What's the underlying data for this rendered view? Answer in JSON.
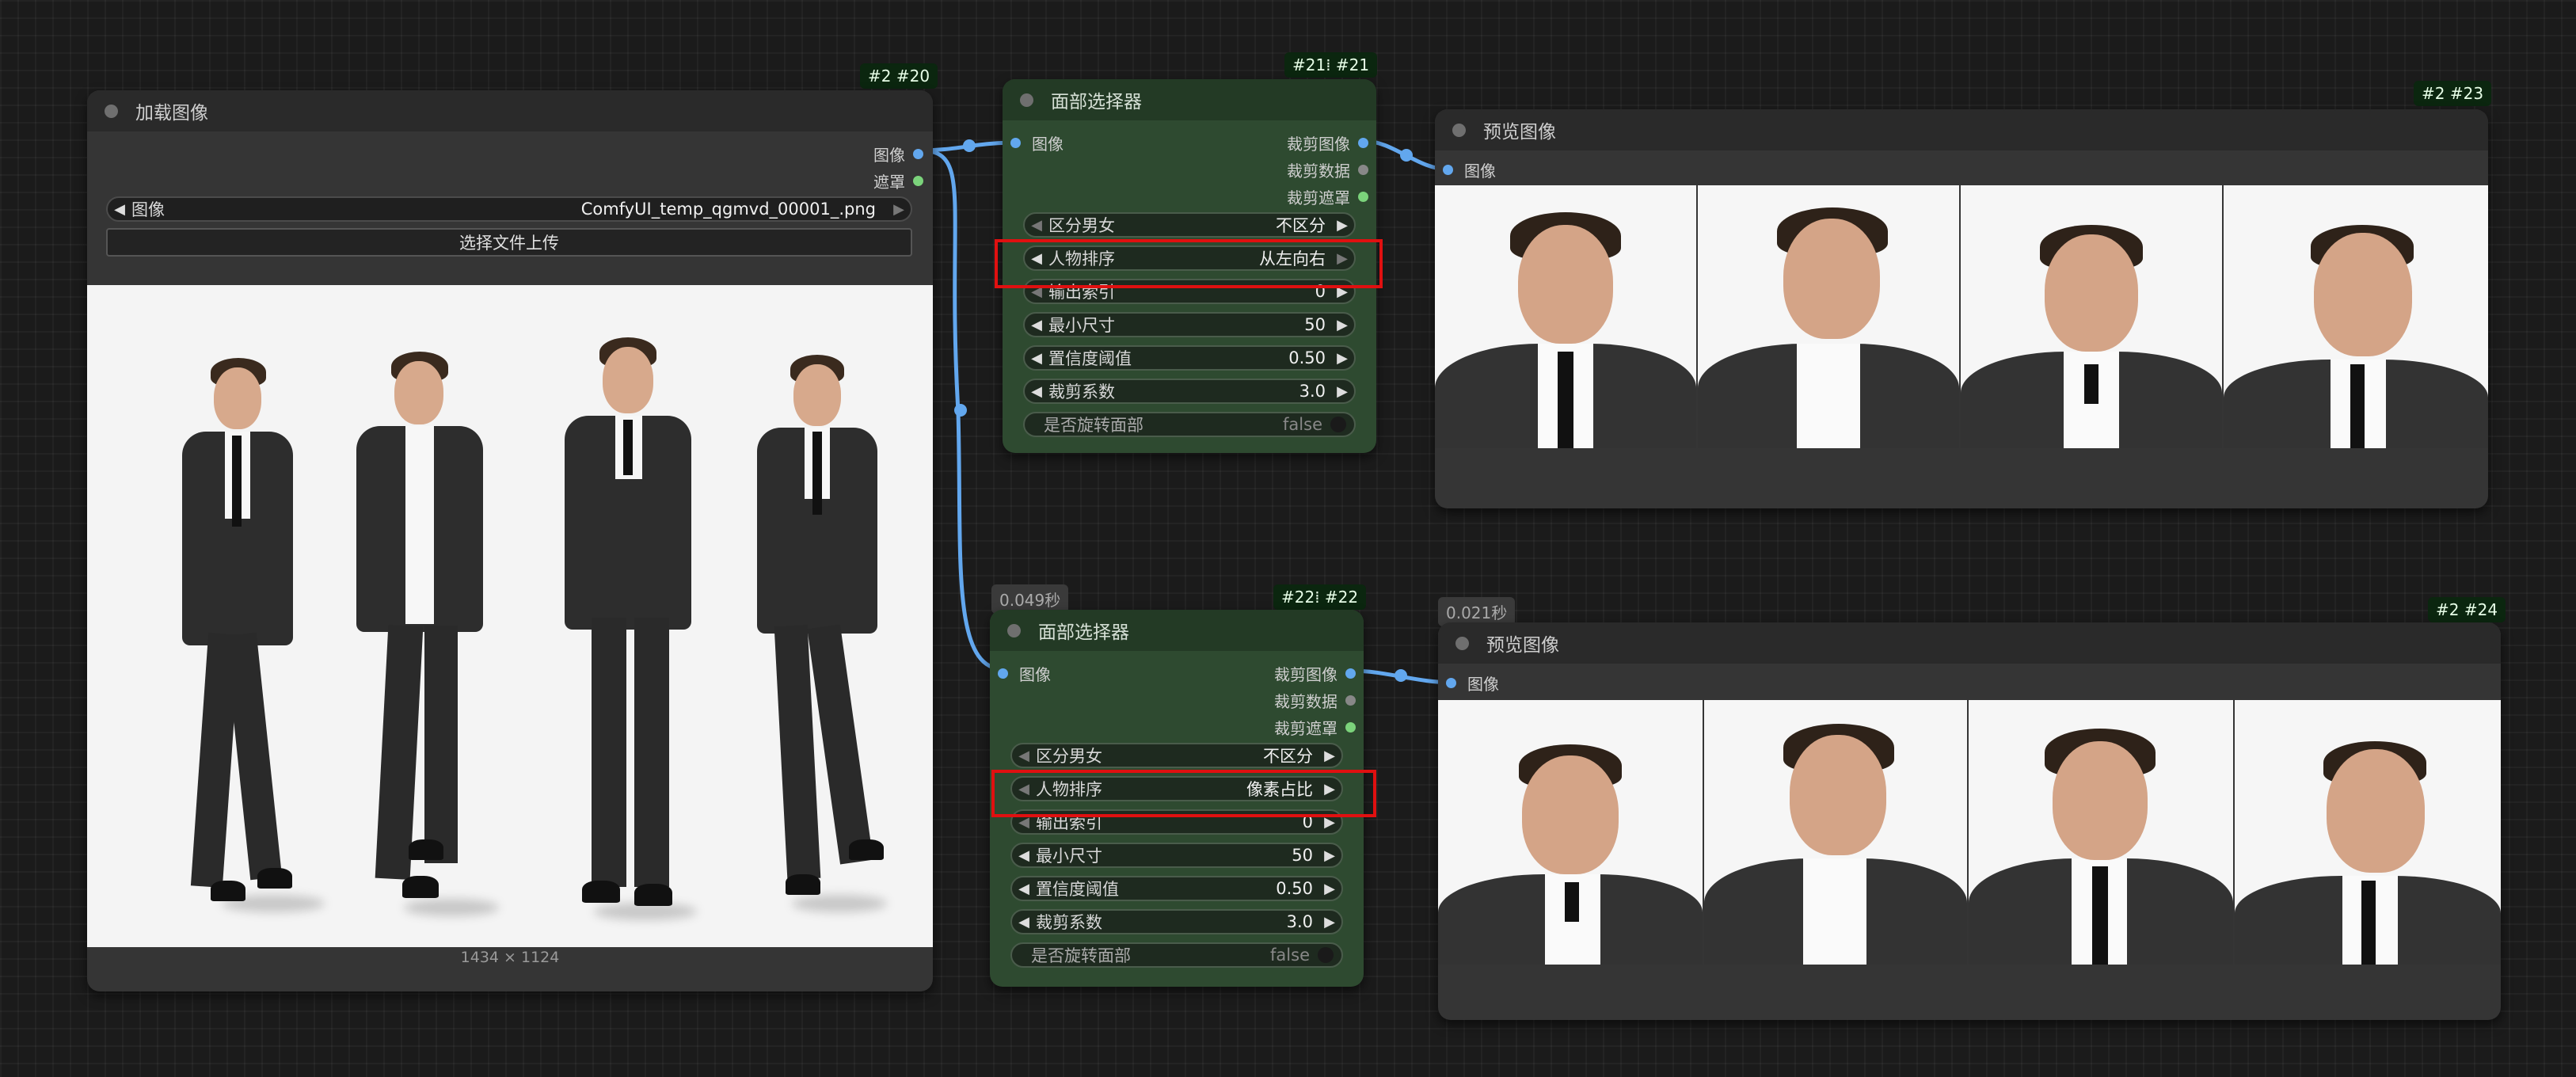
{
  "load_image_node": {
    "badge": "#2 #20",
    "title": "加载图像",
    "outputs": [
      "图像",
      "遮罩"
    ],
    "image_widget": {
      "label": "图像",
      "value": "ComfyUI_temp_qgmvd_00001_.png"
    },
    "upload_button": "选择文件上传",
    "image_size": "1434 × 1124"
  },
  "face_selector_1": {
    "badge": "#21⁞ #21",
    "title": "面部选择器",
    "input": "图像",
    "outputs": [
      "裁剪图像",
      "裁剪数据",
      "裁剪遮罩"
    ],
    "widgets": [
      {
        "label": "区分男女",
        "value": "不区分"
      },
      {
        "label": "人物排序",
        "value": "从左向右"
      },
      {
        "label": "输出索引",
        "value": "0"
      },
      {
        "label": "最小尺寸",
        "value": "50"
      },
      {
        "label": "置信度阈值",
        "value": "0.50"
      },
      {
        "label": "裁剪系数",
        "value": "3.0"
      }
    ],
    "toggle": {
      "label": "是否旋转面部",
      "value": "false"
    }
  },
  "face_selector_2": {
    "time": "0.049秒",
    "badge": "#22⁞ #22",
    "title": "面部选择器",
    "input": "图像",
    "outputs": [
      "裁剪图像",
      "裁剪数据",
      "裁剪遮罩"
    ],
    "widgets": [
      {
        "label": "区分男女",
        "value": "不区分"
      },
      {
        "label": "人物排序",
        "value": "像素占比"
      },
      {
        "label": "输出索引",
        "value": "0"
      },
      {
        "label": "最小尺寸",
        "value": "50"
      },
      {
        "label": "置信度阈值",
        "value": "0.50"
      },
      {
        "label": "裁剪系数",
        "value": "3.0"
      }
    ],
    "toggle": {
      "label": "是否旋转面部",
      "value": "false"
    }
  },
  "preview_1": {
    "badge": "#2 #23",
    "title": "预览图像",
    "input": "图像"
  },
  "preview_2": {
    "time": "0.021秒",
    "badge": "#2 #24",
    "title": "预览图像",
    "input": "图像"
  },
  "colors": {
    "link": "#62a7ee",
    "highlight": "#e01010",
    "node_green": "#2e4a30",
    "node_dark": "#353535"
  }
}
